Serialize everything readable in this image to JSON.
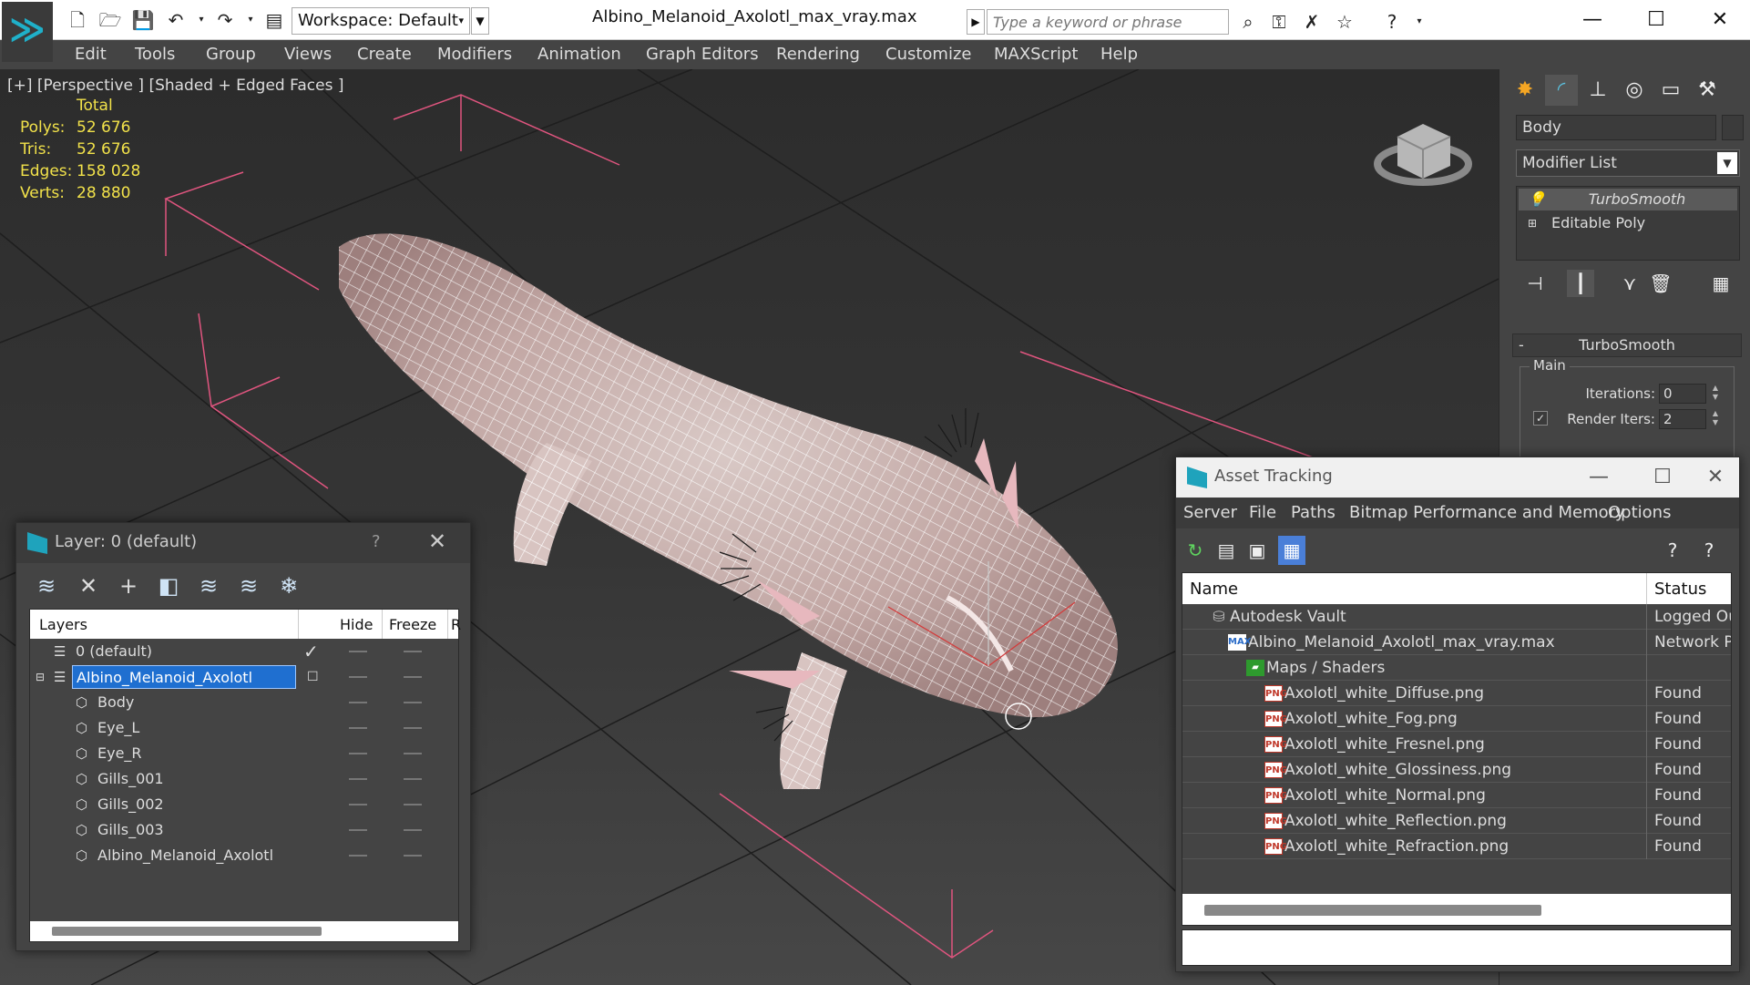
{
  "app": {
    "file_title": "Albino_Melanoid_Axolotl_max_vray.max",
    "workspace_label": "Workspace: Default",
    "search_placeholder": "Type a keyword or phrase",
    "accent_color": "#1fa3bc"
  },
  "menus": [
    "Edit",
    "Tools",
    "Group",
    "Views",
    "Create",
    "Modifiers",
    "Animation",
    "Graph Editors",
    "Rendering",
    "Customize",
    "MAXScript",
    "Help"
  ],
  "viewport": {
    "label": "[+] [Perspective ] [Shaded + Edged Faces ]",
    "stats": {
      "total_label": "Total",
      "polys_label": "Polys:",
      "polys": "52 676",
      "tris_label": "Tris:",
      "tris": "52 676",
      "edges_label": "Edges:",
      "edges": "158 028",
      "verts_label": "Verts:",
      "verts": "28 880"
    }
  },
  "command_panel": {
    "object_name": "Body",
    "modifier_list": "Modifier List",
    "stack": [
      "TurboSmooth",
      "Editable Poly"
    ],
    "rollout_title": "TurboSmooth",
    "group_main": "Main",
    "iterations_label": "Iterations:",
    "iterations": "0",
    "render_iters_label": "Render Iters:",
    "render_iters": "2",
    "render_iters_checked": true
  },
  "layer_dialog": {
    "title": "Layer: 0 (default)",
    "help": "?",
    "col_layers": "Layers",
    "col_hide": "Hide",
    "col_freeze": "Freeze",
    "col_extra": "R",
    "rows": [
      {
        "name": "0 (default)",
        "level": 0
      },
      {
        "name": "Albino_Melanoid_Axolotl",
        "level": 0,
        "selected": true
      },
      {
        "name": "Body",
        "level": 1
      },
      {
        "name": "Eye_L",
        "level": 1
      },
      {
        "name": "Eye_R",
        "level": 1
      },
      {
        "name": "Gills_001",
        "level": 1
      },
      {
        "name": "Gills_002",
        "level": 1
      },
      {
        "name": "Gills_003",
        "level": 1
      },
      {
        "name": "Albino_Melanoid_Axolotl",
        "level": 1
      }
    ]
  },
  "asset_dialog": {
    "title": "Asset Tracking",
    "menus": [
      "Server",
      "File",
      "Paths",
      "Bitmap Performance and Memory",
      "Options"
    ],
    "col_name": "Name",
    "col_status": "Status",
    "rows": [
      {
        "name": "Autodesk Vault",
        "status": "Logged Out",
        "icon": "vault-icon"
      },
      {
        "name": "Albino_Melanoid_Axolotl_max_vray.max",
        "status": "Network Path",
        "icon": "max-file-icon"
      },
      {
        "name": "Maps / Shaders",
        "status": "",
        "icon": "maps-icon"
      },
      {
        "name": "Axolotl_white_Diffuse.png",
        "status": "Found",
        "icon": "png-icon"
      },
      {
        "name": "Axolotl_white_Fog.png",
        "status": "Found",
        "icon": "png-icon"
      },
      {
        "name": "Axolotl_white_Fresnel.png",
        "status": "Found",
        "icon": "png-icon"
      },
      {
        "name": "Axolotl_white_Glossiness.png",
        "status": "Found",
        "icon": "png-icon"
      },
      {
        "name": "Axolotl_white_Normal.png",
        "status": "Found",
        "icon": "png-icon"
      },
      {
        "name": "Axolotl_white_Reflection.png",
        "status": "Found",
        "icon": "png-icon"
      },
      {
        "name": "Axolotl_white_Refraction.png",
        "status": "Found",
        "icon": "png-icon"
      }
    ]
  }
}
